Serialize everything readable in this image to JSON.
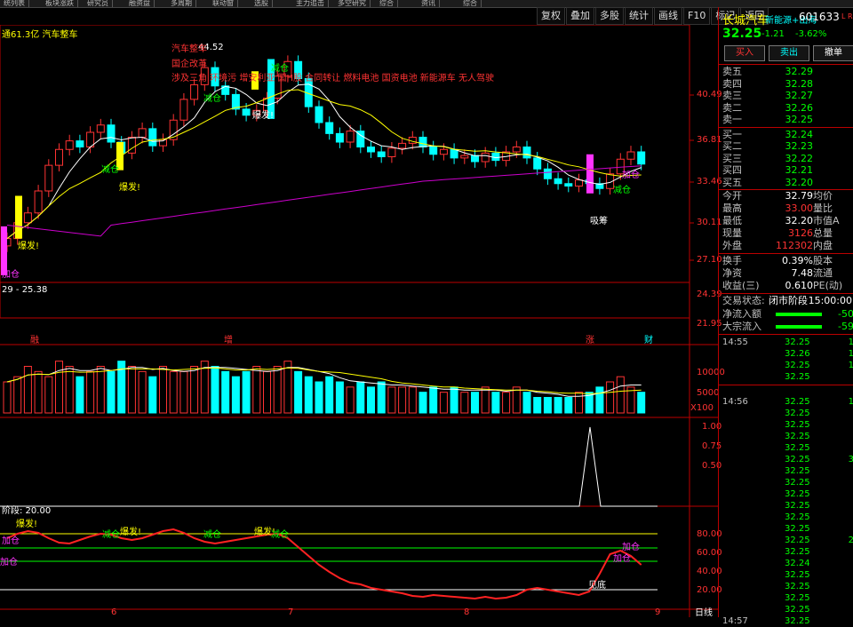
{
  "topbar": {
    "tabs": [
      "统列表",
      "板块涨跌",
      "研究员",
      "融资盘",
      "多周期",
      "联动窗",
      "选股",
      "主力追击",
      "多空研究",
      "综合",
      "资讯",
      "综合"
    ]
  },
  "toolbar": {
    "items": [
      "复权",
      "叠加",
      "多股",
      "统计",
      "画线",
      "F10",
      "标记",
      "返回"
    ]
  },
  "stock": {
    "name": "长城汽车",
    "concept": "新能源+出海",
    "code": "601633",
    "lr": "L R",
    "price": "32.25",
    "change": "-1.21",
    "percent": "-3.62%",
    "buy": "买入",
    "sell": "卖出",
    "cancel": "撤单"
  },
  "orderbook": {
    "asks": [
      {
        "label": "卖五",
        "price": "32.29"
      },
      {
        "label": "卖四",
        "price": "32.28"
      },
      {
        "label": "卖三",
        "price": "32.27"
      },
      {
        "label": "卖二",
        "price": "32.26"
      },
      {
        "label": "卖一",
        "price": "32.25"
      }
    ],
    "bids": [
      {
        "label": "买一",
        "price": "32.24"
      },
      {
        "label": "买二",
        "price": "32.23"
      },
      {
        "label": "买三",
        "price": "32.22"
      },
      {
        "label": "买四",
        "price": "32.21"
      },
      {
        "label": "买五",
        "price": "32.20"
      }
    ]
  },
  "stats": [
    {
      "k": "今开",
      "v": "32.79",
      "k2": "均价"
    },
    {
      "k": "最高",
      "v": "33.00",
      "k2": "量比"
    },
    {
      "k": "最低",
      "v": "32.20",
      "k2": "市值A"
    },
    {
      "k": "现量",
      "v": "3126",
      "k2": "总量"
    },
    {
      "k": "外盘",
      "v": "112302",
      "k2": "内盘"
    },
    {
      "k": "换手",
      "v": "0.39%",
      "k2": "股本"
    },
    {
      "k": "净资",
      "v": "7.48",
      "k2": "流通"
    },
    {
      "k": "收益(三)",
      "v": "0.610",
      "k2": "PE(动)"
    }
  ],
  "status": {
    "label": "交易状态:",
    "value": "闭市阶段",
    "time": "15:00:00"
  },
  "flows": [
    {
      "label": "净流入额",
      "value": "-50"
    },
    {
      "label": "大宗流入",
      "value": "-59"
    }
  ],
  "ticks": [
    {
      "t": "14:55",
      "p": "32.25",
      "q": "1"
    },
    {
      "t": "",
      "p": "32.26",
      "q": "1"
    },
    {
      "t": "",
      "p": "32.25",
      "q": "1"
    },
    {
      "t": "",
      "p": "32.25",
      "q": ""
    },
    {
      "t": "14:56",
      "p": "32.25",
      "q": "1"
    },
    {
      "t": "",
      "p": "32.25",
      "q": ""
    },
    {
      "t": "",
      "p": "32.25",
      "q": ""
    },
    {
      "t": "",
      "p": "32.25",
      "q": ""
    },
    {
      "t": "",
      "p": "32.25",
      "q": ""
    },
    {
      "t": "",
      "p": "32.25",
      "q": "3"
    },
    {
      "t": "",
      "p": "32.25",
      "q": ""
    },
    {
      "t": "",
      "p": "32.25",
      "q": ""
    },
    {
      "t": "",
      "p": "32.25",
      "q": ""
    },
    {
      "t": "",
      "p": "32.25",
      "q": ""
    },
    {
      "t": "",
      "p": "32.25",
      "q": ""
    },
    {
      "t": "",
      "p": "32.25",
      "q": ""
    },
    {
      "t": "",
      "p": "32.25",
      "q": "2"
    },
    {
      "t": "",
      "p": "32.25",
      "q": ""
    },
    {
      "t": "",
      "p": "32.24",
      "q": ""
    },
    {
      "t": "",
      "p": "32.25",
      "q": ""
    },
    {
      "t": "",
      "p": "32.25",
      "q": ""
    },
    {
      "t": "",
      "p": "32.25",
      "q": ""
    },
    {
      "t": "",
      "p": "32.25",
      "q": ""
    },
    {
      "t": "14:57",
      "p": "32.25",
      "q": ""
    }
  ],
  "chart": {
    "header": "通61.3亿 汽车整车",
    "low_label": "29 - 25.38",
    "hi_label": "44.52",
    "annotations": [
      "汽车整车",
      "国企改革",
      "涉及三角 环境污 增安利亚 国H股 合同转让 燃料电池 国资电池 新能源车 无人驾驶"
    ],
    "price_axis": [
      "40.49",
      "36.81",
      "33.46",
      "30.11",
      "27.10",
      "24.39",
      "21.95"
    ],
    "vol_axis": [
      "10000",
      "5000",
      "X100"
    ],
    "ind_axis": [
      "1.00",
      "0.75",
      "0.50"
    ],
    "osc_title": "阶段: 20.00",
    "osc_axis": [
      "80.00",
      "60.00",
      "40.00",
      "20.00"
    ],
    "date_axis": [
      "6",
      "7",
      "8",
      "9"
    ],
    "bottom_right": "日线",
    "events": [
      "融",
      "增",
      "涨",
      "财"
    ],
    "signals": {
      "burst": "爆发!",
      "bao_cang": "减仓",
      "xi_chou": "吸筹",
      "jia_cang": "加仓",
      "di": "见底"
    }
  }
}
